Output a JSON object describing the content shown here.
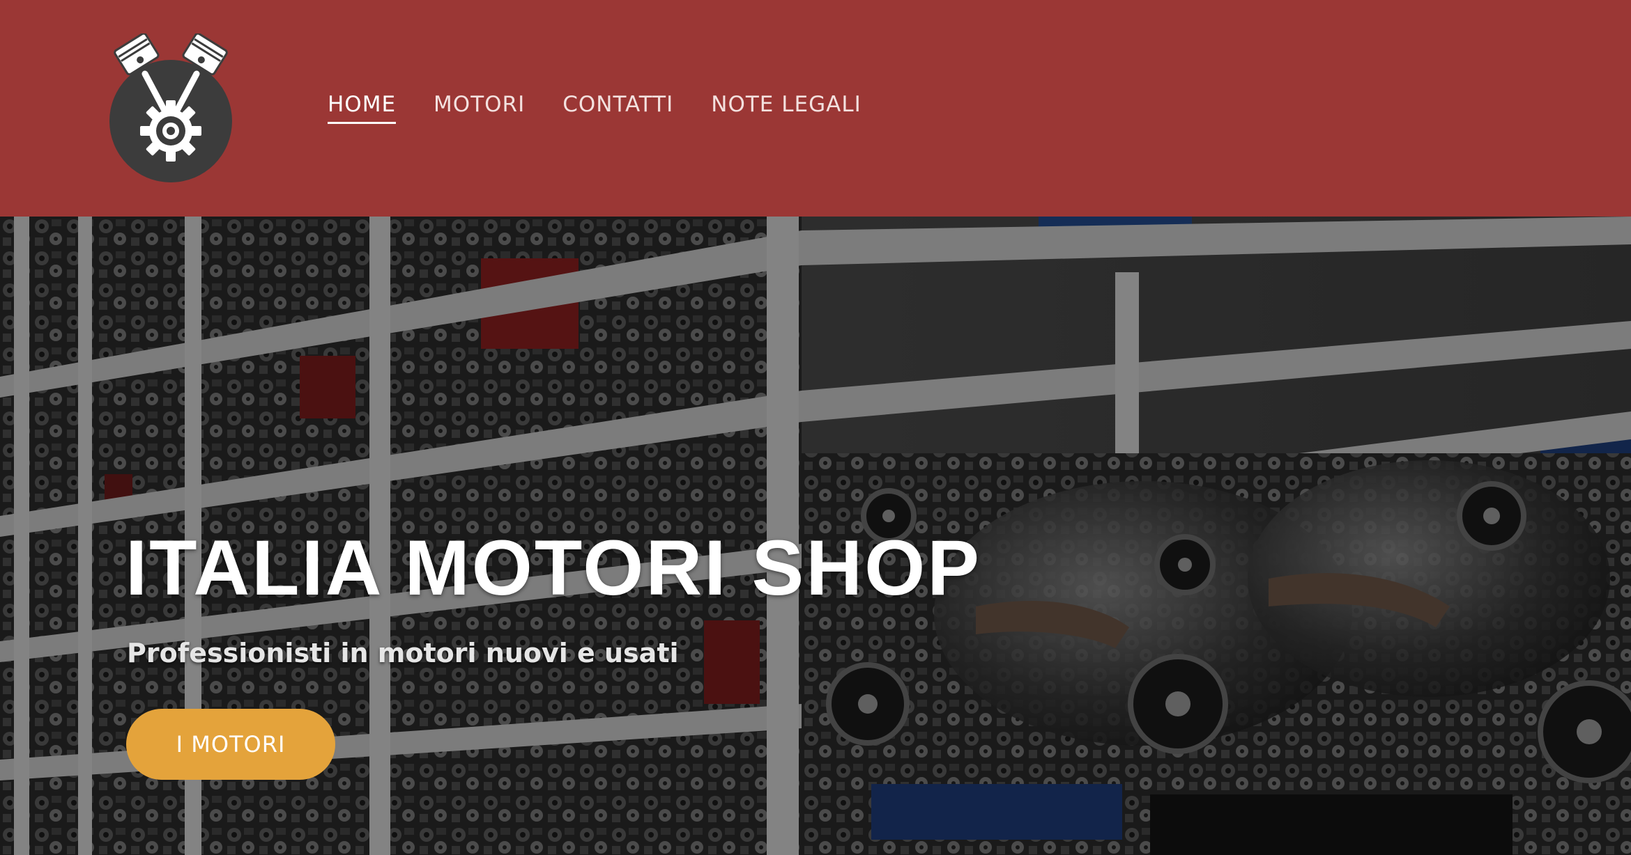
{
  "header": {
    "logo_icon": "engine-pistons-gear-logo",
    "background_color": "#9b3735",
    "nav": [
      {
        "label": "HOME",
        "active": true
      },
      {
        "label": "MOTORI",
        "active": false
      },
      {
        "label": "CONTATTI",
        "active": false
      },
      {
        "label": "NOTE LEGALI",
        "active": false
      }
    ]
  },
  "hero": {
    "background_image": "engine-warehouse-shelves-photo",
    "title": "ITALIA MOTORI SHOP",
    "subtitle": "Professionisti in motori nuovi e usati",
    "button_label": "I MOTORI",
    "button_color": "#e4a33b"
  }
}
